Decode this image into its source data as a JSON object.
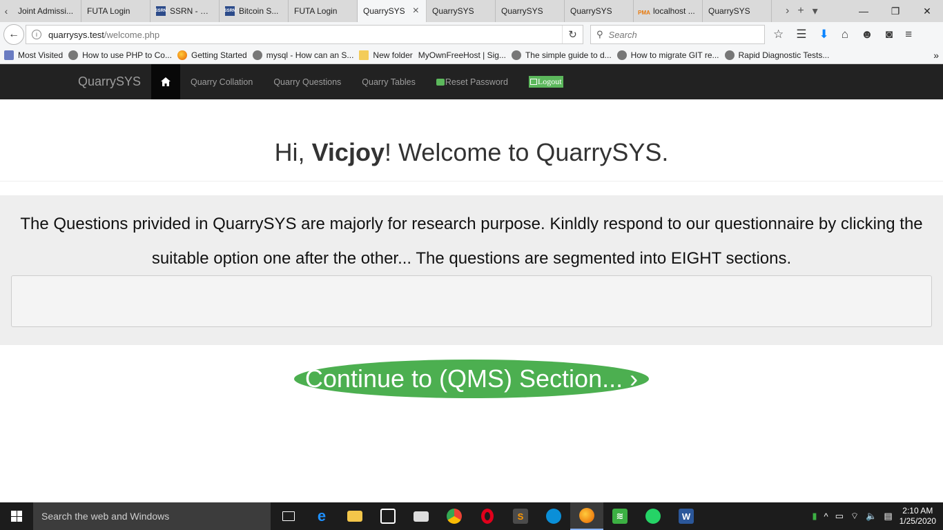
{
  "browser": {
    "tabs": [
      {
        "label": "Joint Admissi...",
        "icon": "page-icon"
      },
      {
        "label": "FUTA Login",
        "icon": "page-icon"
      },
      {
        "label": "SSRN - SS...",
        "icon": "ssrn-icon"
      },
      {
        "label": "Bitcoin S...",
        "icon": "ssrn-icon"
      },
      {
        "label": "FUTA Login",
        "icon": "page-icon"
      },
      {
        "label": "QuarrySYS",
        "icon": "page-icon",
        "active": true
      },
      {
        "label": "QuarrySYS",
        "icon": "page-icon"
      },
      {
        "label": "QuarrySYS",
        "icon": "page-icon"
      },
      {
        "label": "QuarrySYS",
        "icon": "page-icon"
      },
      {
        "label": "localhost ...",
        "icon": "phpmyadmin-icon"
      },
      {
        "label": "QuarrySYS",
        "icon": "page-icon"
      }
    ],
    "url_host": "quarrysys.test",
    "url_path": "/welcome.php",
    "search_placeholder": "Search",
    "bookmarks": [
      {
        "label": "Most Visited",
        "icon": "star"
      },
      {
        "label": "How to use PHP to Co...",
        "icon": "globe"
      },
      {
        "label": "Getting Started",
        "icon": "ff"
      },
      {
        "label": "mysql - How can an S...",
        "icon": "globe"
      },
      {
        "label": "New folder",
        "icon": "folder"
      },
      {
        "label": "MyOwnFreeHost | Sig...",
        "icon": "none"
      },
      {
        "label": "The simple guide to d...",
        "icon": "globe"
      },
      {
        "label": "How to migrate GIT re...",
        "icon": "globe"
      },
      {
        "label": "Rapid Diagnostic Tests...",
        "icon": "globe"
      }
    ]
  },
  "site": {
    "brand": "QuarrySYS",
    "nav": {
      "collation": "Quarry Collation",
      "questions": "Quarry Questions",
      "tables": "Quarry Tables",
      "reset": "Reset Password",
      "logout": "Logout"
    },
    "greeting": {
      "prefix": "Hi, ",
      "username": "Vicjoy",
      "suffix": "! Welcome to QuarrySYS."
    },
    "intro": "The Questions privided in QuarrySYS are majorly for research purpose. Kinldly respond to our questionnaire by clicking the suitable option one after the other... The questions are segmented into EIGHT sections.",
    "cta": "Continue to (QMS) Section... ›"
  },
  "taskbar": {
    "search_placeholder": "Search the web and Windows",
    "time": "2:10 AM",
    "date": "1/25/2020"
  },
  "colors": {
    "navbar_bg": "#222222",
    "accent_green": "#4caf50",
    "jumbotron_bg": "#eeeeee"
  }
}
